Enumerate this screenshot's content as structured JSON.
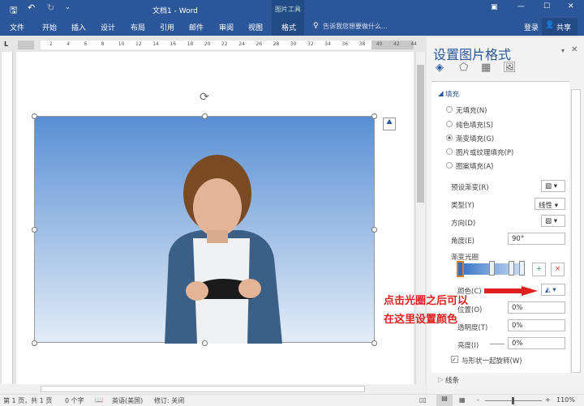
{
  "titlebar": {
    "title": "文档1 - Word",
    "context_tab": "图片工具",
    "icons": [
      "save-icon",
      "undo-icon",
      "redo-icon",
      "customize-icon",
      "ribbon-display-icon",
      "minimize-icon",
      "maximize-icon",
      "close-icon"
    ]
  },
  "tabs": [
    "文件",
    "开始",
    "插入",
    "设计",
    "布局",
    "引用",
    "邮件",
    "审阅",
    "视图",
    "格式"
  ],
  "tell_me": "告诉我您想要做什么...",
  "login": "登录",
  "share": "共享",
  "ruler": {
    "tab_selector": "L",
    "ticks": [
      "2",
      "4",
      "6",
      "8",
      "10",
      "12",
      "14",
      "16",
      "18",
      "20",
      "22",
      "24",
      "26",
      "28",
      "30",
      "32",
      "34",
      "36",
      "38",
      "40",
      "42",
      "44"
    ]
  },
  "pane": {
    "title": "设置图片格式",
    "section_fill": "填充",
    "section_line": "线条",
    "fill_options": [
      "无填充(N)",
      "纯色填充(S)",
      "渐变填充(G)",
      "图片或纹理填充(P)",
      "图案填充(A)"
    ],
    "selected_fill": 2,
    "preset": "预设渐变(R)",
    "type_label": "类型(Y)",
    "type_value": "线性",
    "direction": "方向(D)",
    "angle_label": "角度(E)",
    "angle_value": "90°",
    "stops_label": "渐变光圈",
    "color_label": "颜色(C)",
    "position_label": "位置(O)",
    "position_value": "0%",
    "transparency_label": "透明度(T)",
    "transparency_value": "0%",
    "brightness_label": "亮度(I)",
    "brightness_value": "0%",
    "rotate_label": "与形状一起旋转(W)",
    "rotate_checked": true
  },
  "annotation": {
    "line1": "点击光圈之后可以",
    "line2": "在这里设置颜色",
    "color": "#e02020"
  },
  "status": {
    "page": "第 1 页，共 1 页",
    "words": "0 个字",
    "language": "英语(美国)",
    "revision": "修订: 关闭",
    "zoom": "110%"
  },
  "colors": {
    "accent": "#2b579a"
  }
}
